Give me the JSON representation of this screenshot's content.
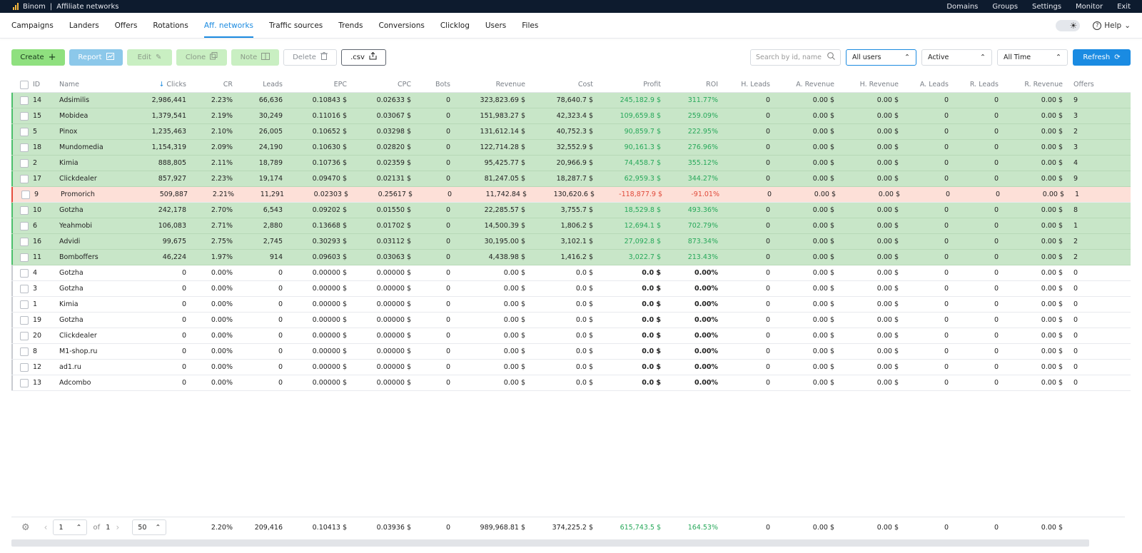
{
  "app": {
    "brand": "Binom",
    "section": "Affiliate networks"
  },
  "topnav": [
    "Domains",
    "Groups",
    "Settings",
    "Monitor",
    "Exit"
  ],
  "nav": {
    "items": [
      "Campaigns",
      "Landers",
      "Offers",
      "Rotations",
      "Aff. networks",
      "Traffic sources",
      "Trends",
      "Conversions",
      "Clicklog",
      "Users",
      "Files"
    ],
    "active": "Aff. networks",
    "help": "Help"
  },
  "toolbar": {
    "create": "Create",
    "report": "Report",
    "edit": "Edit",
    "clone": "Clone",
    "note": "Note",
    "delete": "Delete",
    "csv": ".csv",
    "search_placeholder": "Search by id, name",
    "users_select": "All users",
    "status_select": "Active",
    "time_select": "All Time",
    "refresh": "Refresh"
  },
  "columns": [
    "ID",
    "Name",
    "Clicks",
    "CR",
    "Leads",
    "EPC",
    "CPC",
    "Bots",
    "Revenue",
    "Cost",
    "Profit",
    "ROI",
    "H. Leads",
    "A. Revenue",
    "H. Revenue",
    "A. Leads",
    "R. Leads",
    "R. Revenue",
    "Offers"
  ],
  "rows": [
    {
      "id": "14",
      "name": "Adsimilis",
      "clicks": "2,986,441",
      "cr": "2.23%",
      "leads": "66,636",
      "epc": "0.10843 $",
      "cpc": "0.02633 $",
      "bots": "0",
      "revenue": "323,823.69 $",
      "cost": "78,640.7 $",
      "profit": "245,182.9 $",
      "roi": "311.77%",
      "hl": "0",
      "ar": "0.00 $",
      "hr": "0.00 $",
      "al": "0",
      "rl": "0",
      "rr": "0.00 $",
      "offers": "9",
      "status": "green"
    },
    {
      "id": "15",
      "name": "Mobidea",
      "clicks": "1,379,541",
      "cr": "2.19%",
      "leads": "30,249",
      "epc": "0.11016 $",
      "cpc": "0.03067 $",
      "bots": "0",
      "revenue": "151,983.27 $",
      "cost": "42,323.4 $",
      "profit": "109,659.8 $",
      "roi": "259.09%",
      "hl": "0",
      "ar": "0.00 $",
      "hr": "0.00 $",
      "al": "0",
      "rl": "0",
      "rr": "0.00 $",
      "offers": "3",
      "status": "green"
    },
    {
      "id": "5",
      "name": "Pinox",
      "clicks": "1,235,463",
      "cr": "2.10%",
      "leads": "26,005",
      "epc": "0.10652 $",
      "cpc": "0.03298 $",
      "bots": "0",
      "revenue": "131,612.14 $",
      "cost": "40,752.3 $",
      "profit": "90,859.7 $",
      "roi": "222.95%",
      "hl": "0",
      "ar": "0.00 $",
      "hr": "0.00 $",
      "al": "0",
      "rl": "0",
      "rr": "0.00 $",
      "offers": "2",
      "status": "green"
    },
    {
      "id": "18",
      "name": "Mundomedia",
      "clicks": "1,154,319",
      "cr": "2.09%",
      "leads": "24,190",
      "epc": "0.10630 $",
      "cpc": "0.02820 $",
      "bots": "0",
      "revenue": "122,714.28 $",
      "cost": "32,552.9 $",
      "profit": "90,161.3 $",
      "roi": "276.96%",
      "hl": "0",
      "ar": "0.00 $",
      "hr": "0.00 $",
      "al": "0",
      "rl": "0",
      "rr": "0.00 $",
      "offers": "3",
      "status": "green"
    },
    {
      "id": "2",
      "name": "Kimia",
      "clicks": "888,805",
      "cr": "2.11%",
      "leads": "18,789",
      "epc": "0.10736 $",
      "cpc": "0.02359 $",
      "bots": "0",
      "revenue": "95,425.77 $",
      "cost": "20,966.9 $",
      "profit": "74,458.7 $",
      "roi": "355.12%",
      "hl": "0",
      "ar": "0.00 $",
      "hr": "0.00 $",
      "al": "0",
      "rl": "0",
      "rr": "0.00 $",
      "offers": "4",
      "status": "green"
    },
    {
      "id": "17",
      "name": "Clickdealer",
      "clicks": "857,927",
      "cr": "2.23%",
      "leads": "19,174",
      "epc": "0.09470 $",
      "cpc": "0.02131 $",
      "bots": "0",
      "revenue": "81,247.05 $",
      "cost": "18,287.7 $",
      "profit": "62,959.3 $",
      "roi": "344.27%",
      "hl": "0",
      "ar": "0.00 $",
      "hr": "0.00 $",
      "al": "0",
      "rl": "0",
      "rr": "0.00 $",
      "offers": "9",
      "status": "green"
    },
    {
      "id": "9",
      "name": "Promorich",
      "clicks": "509,887",
      "cr": "2.21%",
      "leads": "11,291",
      "epc": "0.02303 $",
      "cpc": "0.25617 $",
      "bots": "0",
      "revenue": "11,742.84 $",
      "cost": "130,620.6 $",
      "profit": "-118,877.9 $",
      "roi": "-91.01%",
      "hl": "0",
      "ar": "0.00 $",
      "hr": "0.00 $",
      "al": "0",
      "rl": "0",
      "rr": "0.00 $",
      "offers": "1",
      "status": "red"
    },
    {
      "id": "10",
      "name": "Gotzha",
      "clicks": "242,178",
      "cr": "2.70%",
      "leads": "6,543",
      "epc": "0.09202 $",
      "cpc": "0.01550 $",
      "bots": "0",
      "revenue": "22,285.57 $",
      "cost": "3,755.7 $",
      "profit": "18,529.8 $",
      "roi": "493.36%",
      "hl": "0",
      "ar": "0.00 $",
      "hr": "0.00 $",
      "al": "0",
      "rl": "0",
      "rr": "0.00 $",
      "offers": "8",
      "status": "green"
    },
    {
      "id": "6",
      "name": "Yeahmobi",
      "clicks": "106,083",
      "cr": "2.71%",
      "leads": "2,880",
      "epc": "0.13668 $",
      "cpc": "0.01702 $",
      "bots": "0",
      "revenue": "14,500.39 $",
      "cost": "1,806.2 $",
      "profit": "12,694.1 $",
      "roi": "702.79%",
      "hl": "0",
      "ar": "0.00 $",
      "hr": "0.00 $",
      "al": "0",
      "rl": "0",
      "rr": "0.00 $",
      "offers": "1",
      "status": "green"
    },
    {
      "id": "16",
      "name": "Advidi",
      "clicks": "99,675",
      "cr": "2.75%",
      "leads": "2,745",
      "epc": "0.30293 $",
      "cpc": "0.03112 $",
      "bots": "0",
      "revenue": "30,195.00 $",
      "cost": "3,102.1 $",
      "profit": "27,092.8 $",
      "roi": "873.34%",
      "hl": "0",
      "ar": "0.00 $",
      "hr": "0.00 $",
      "al": "0",
      "rl": "0",
      "rr": "0.00 $",
      "offers": "2",
      "status": "green"
    },
    {
      "id": "11",
      "name": "Bomboffers",
      "clicks": "46,224",
      "cr": "1.97%",
      "leads": "914",
      "epc": "0.09603 $",
      "cpc": "0.03063 $",
      "bots": "0",
      "revenue": "4,438.98 $",
      "cost": "1,416.2 $",
      "profit": "3,022.7 $",
      "roi": "213.43%",
      "hl": "0",
      "ar": "0.00 $",
      "hr": "0.00 $",
      "al": "0",
      "rl": "0",
      "rr": "0.00 $",
      "offers": "2",
      "status": "green"
    },
    {
      "id": "4",
      "name": "Gotzha",
      "clicks": "0",
      "cr": "0.00%",
      "leads": "0",
      "epc": "0.00000 $",
      "cpc": "0.00000 $",
      "bots": "0",
      "revenue": "0.00 $",
      "cost": "0.0 $",
      "profit": "0.0 $",
      "roi": "0.00%",
      "hl": "0",
      "ar": "0.00 $",
      "hr": "0.00 $",
      "al": "0",
      "rl": "0",
      "rr": "0.00 $",
      "offers": "0",
      "status": "plain"
    },
    {
      "id": "3",
      "name": "Gotzha",
      "clicks": "0",
      "cr": "0.00%",
      "leads": "0",
      "epc": "0.00000 $",
      "cpc": "0.00000 $",
      "bots": "0",
      "revenue": "0.00 $",
      "cost": "0.0 $",
      "profit": "0.0 $",
      "roi": "0.00%",
      "hl": "0",
      "ar": "0.00 $",
      "hr": "0.00 $",
      "al": "0",
      "rl": "0",
      "rr": "0.00 $",
      "offers": "0",
      "status": "plain"
    },
    {
      "id": "1",
      "name": "Kimia",
      "clicks": "0",
      "cr": "0.00%",
      "leads": "0",
      "epc": "0.00000 $",
      "cpc": "0.00000 $",
      "bots": "0",
      "revenue": "0.00 $",
      "cost": "0.0 $",
      "profit": "0.0 $",
      "roi": "0.00%",
      "hl": "0",
      "ar": "0.00 $",
      "hr": "0.00 $",
      "al": "0",
      "rl": "0",
      "rr": "0.00 $",
      "offers": "0",
      "status": "plain"
    },
    {
      "id": "19",
      "name": "Gotzha",
      "clicks": "0",
      "cr": "0.00%",
      "leads": "0",
      "epc": "0.00000 $",
      "cpc": "0.00000 $",
      "bots": "0",
      "revenue": "0.00 $",
      "cost": "0.0 $",
      "profit": "0.0 $",
      "roi": "0.00%",
      "hl": "0",
      "ar": "0.00 $",
      "hr": "0.00 $",
      "al": "0",
      "rl": "0",
      "rr": "0.00 $",
      "offers": "0",
      "status": "plain"
    },
    {
      "id": "20",
      "name": "Clickdealer",
      "clicks": "0",
      "cr": "0.00%",
      "leads": "0",
      "epc": "0.00000 $",
      "cpc": "0.00000 $",
      "bots": "0",
      "revenue": "0.00 $",
      "cost": "0.0 $",
      "profit": "0.0 $",
      "roi": "0.00%",
      "hl": "0",
      "ar": "0.00 $",
      "hr": "0.00 $",
      "al": "0",
      "rl": "0",
      "rr": "0.00 $",
      "offers": "0",
      "status": "plain"
    },
    {
      "id": "8",
      "name": "M1-shop.ru",
      "clicks": "0",
      "cr": "0.00%",
      "leads": "0",
      "epc": "0.00000 $",
      "cpc": "0.00000 $",
      "bots": "0",
      "revenue": "0.00 $",
      "cost": "0.0 $",
      "profit": "0.0 $",
      "roi": "0.00%",
      "hl": "0",
      "ar": "0.00 $",
      "hr": "0.00 $",
      "al": "0",
      "rl": "0",
      "rr": "0.00 $",
      "offers": "0",
      "status": "plain"
    },
    {
      "id": "12",
      "name": "ad1.ru",
      "clicks": "0",
      "cr": "0.00%",
      "leads": "0",
      "epc": "0.00000 $",
      "cpc": "0.00000 $",
      "bots": "0",
      "revenue": "0.00 $",
      "cost": "0.0 $",
      "profit": "0.0 $",
      "roi": "0.00%",
      "hl": "0",
      "ar": "0.00 $",
      "hr": "0.00 $",
      "al": "0",
      "rl": "0",
      "rr": "0.00 $",
      "offers": "0",
      "status": "plain"
    },
    {
      "id": "13",
      "name": "Adcombo",
      "clicks": "0",
      "cr": "0.00%",
      "leads": "0",
      "epc": "0.00000 $",
      "cpc": "0.00000 $",
      "bots": "0",
      "revenue": "0.00 $",
      "cost": "0.0 $",
      "profit": "0.0 $",
      "roi": "0.00%",
      "hl": "0",
      "ar": "0.00 $",
      "hr": "0.00 $",
      "al": "0",
      "rl": "0",
      "rr": "0.00 $",
      "offers": "0",
      "status": "plain"
    }
  ],
  "footer": {
    "page": "1",
    "of_label": "of",
    "total_pages": "1",
    "per_page": "50",
    "totals": {
      "cr": "2.20%",
      "leads": "209,416",
      "epc": "0.10413 $",
      "cpc": "0.03936 $",
      "bots": "0",
      "revenue": "989,968.81 $",
      "cost": "374,225.2 $",
      "profit": "615,743.5 $",
      "roi": "164.53%",
      "hl": "0",
      "ar": "0.00 $",
      "hr": "0.00 $",
      "al": "0",
      "rl": "0",
      "rr": "0.00 $"
    }
  },
  "colors": {
    "accent": "#1c8be0",
    "positive": "#27a85a",
    "negative": "#e04a3a",
    "row_green": "#c8e6c8",
    "row_red": "#fde0d8",
    "topbar": "#0d1b2e"
  }
}
